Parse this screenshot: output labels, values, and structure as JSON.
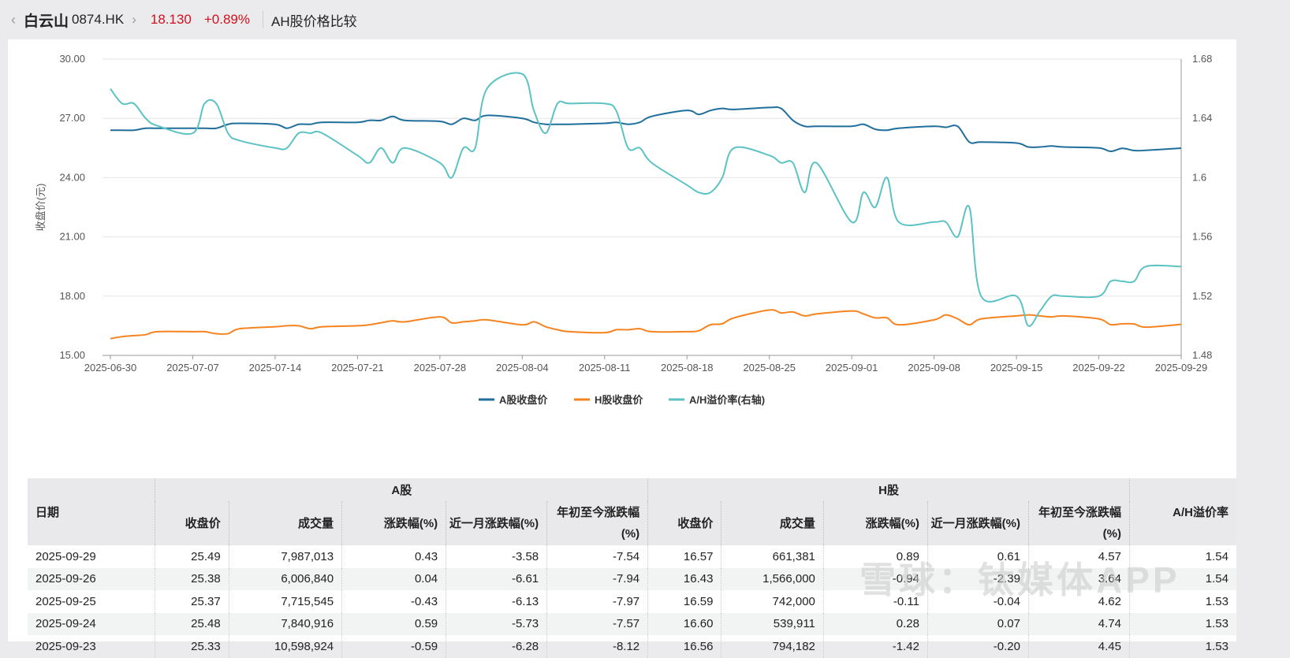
{
  "header": {
    "back_icon": "chevron-left",
    "name": "白云山",
    "code": "0874.HK",
    "next_icon": "chevron-right",
    "price": "18.130",
    "change": "+0.89%",
    "page_title": "AH股价格比较"
  },
  "colors": {
    "a_price": "#1f6e9c",
    "h_price": "#f5831f",
    "ratio": "#5cc2c4",
    "up": "#d0101c"
  },
  "chart_data": {
    "type": "line",
    "ylabel": "收盘价(元)",
    "ylim": [
      15,
      30
    ],
    "y2lim": [
      1.48,
      1.68
    ],
    "yticks": [
      "30.00",
      "27.00",
      "24.00",
      "21.00",
      "18.00",
      "15.00"
    ],
    "y2ticks": [
      "1.68",
      "1.64",
      "1.6",
      "1.56",
      "1.52",
      "1.48"
    ],
    "xticks": [
      "2025-06-30",
      "2025-07-07",
      "2025-07-14",
      "2025-07-21",
      "2025-07-28",
      "2025-08-04",
      "2025-08-11",
      "2025-08-18",
      "2025-08-25",
      "2025-09-01",
      "2025-09-08",
      "2025-09-15",
      "2025-09-22",
      "2025-09-29"
    ],
    "grid": true,
    "legend_position": "bottom",
    "x": [
      "2025-06-30",
      "2025-07-01",
      "2025-07-02",
      "2025-07-03",
      "2025-07-04",
      "2025-07-07",
      "2025-07-08",
      "2025-07-09",
      "2025-07-10",
      "2025-07-11",
      "2025-07-14",
      "2025-07-15",
      "2025-07-16",
      "2025-07-17",
      "2025-07-18",
      "2025-07-21",
      "2025-07-22",
      "2025-07-23",
      "2025-07-24",
      "2025-07-25",
      "2025-07-28",
      "2025-07-29",
      "2025-07-30",
      "2025-07-31",
      "2025-08-01",
      "2025-08-04",
      "2025-08-05",
      "2025-08-06",
      "2025-08-07",
      "2025-08-08",
      "2025-08-11",
      "2025-08-12",
      "2025-08-13",
      "2025-08-14",
      "2025-08-15",
      "2025-08-18",
      "2025-08-19",
      "2025-08-20",
      "2025-08-21",
      "2025-08-22",
      "2025-08-25",
      "2025-08-26",
      "2025-08-27",
      "2025-08-28",
      "2025-08-29",
      "2025-09-01",
      "2025-09-02",
      "2025-09-03",
      "2025-09-04",
      "2025-09-05",
      "2025-09-08",
      "2025-09-09",
      "2025-09-10",
      "2025-09-11",
      "2025-09-12",
      "2025-09-15",
      "2025-09-16",
      "2025-09-17",
      "2025-09-18",
      "2025-09-19",
      "2025-09-22",
      "2025-09-23",
      "2025-09-24",
      "2025-09-25",
      "2025-09-26",
      "2025-09-29"
    ],
    "series": [
      {
        "name": "A股收盘价",
        "axis": "left",
        "values": [
          26.4,
          26.4,
          26.4,
          26.5,
          26.5,
          26.5,
          26.5,
          26.5,
          26.7,
          26.75,
          26.7,
          26.5,
          26.7,
          26.7,
          26.8,
          26.8,
          26.9,
          26.9,
          27.1,
          26.9,
          26.85,
          26.7,
          27.0,
          26.9,
          27.15,
          27.0,
          26.8,
          26.7,
          26.7,
          26.7,
          26.75,
          26.8,
          26.7,
          26.8,
          27.1,
          27.4,
          27.2,
          27.4,
          27.5,
          27.45,
          27.55,
          27.5,
          26.9,
          26.6,
          26.6,
          26.6,
          26.7,
          26.45,
          26.4,
          26.5,
          26.6,
          26.55,
          26.6,
          25.8,
          25.8,
          25.75,
          25.55,
          25.55,
          25.6,
          25.55,
          25.5,
          25.33,
          25.48,
          25.37,
          25.38,
          25.49
        ]
      },
      {
        "name": "H股收盘价",
        "axis": "left",
        "values": [
          15.85,
          15.95,
          16.0,
          16.05,
          16.2,
          16.2,
          16.2,
          16.1,
          16.1,
          16.35,
          16.45,
          16.5,
          16.5,
          16.35,
          16.45,
          16.5,
          16.55,
          16.65,
          16.75,
          16.7,
          16.95,
          16.65,
          16.7,
          16.75,
          16.8,
          16.55,
          16.7,
          16.45,
          16.3,
          16.2,
          16.15,
          16.3,
          16.3,
          16.35,
          16.2,
          16.2,
          16.25,
          16.55,
          16.6,
          16.9,
          17.3,
          17.15,
          17.2,
          17.0,
          17.1,
          17.25,
          17.1,
          16.9,
          16.9,
          16.55,
          16.8,
          17.05,
          16.85,
          16.55,
          16.85,
          17.0,
          17.05,
          17.0,
          16.95,
          17.0,
          16.85,
          16.56,
          16.6,
          16.59,
          16.43,
          16.57
        ]
      },
      {
        "name": "A/H溢价率(右轴)",
        "axis": "right",
        "values": [
          1.66,
          1.65,
          1.65,
          1.64,
          1.635,
          1.63,
          1.65,
          1.65,
          1.63,
          1.625,
          1.62,
          1.62,
          1.63,
          1.63,
          1.63,
          1.615,
          1.61,
          1.62,
          1.61,
          1.62,
          1.61,
          1.6,
          1.62,
          1.62,
          1.66,
          1.67,
          1.645,
          1.63,
          1.65,
          1.65,
          1.65,
          1.645,
          1.62,
          1.62,
          1.61,
          1.595,
          1.59,
          1.59,
          1.6,
          1.62,
          1.615,
          1.61,
          1.61,
          1.59,
          1.61,
          1.57,
          1.59,
          1.58,
          1.6,
          1.57,
          1.57,
          1.57,
          1.56,
          1.58,
          1.52,
          1.52,
          1.5,
          1.51,
          1.52,
          1.52,
          1.52,
          1.53,
          1.53,
          1.53,
          1.54,
          1.54
        ]
      }
    ]
  },
  "table": {
    "date_header": "日期",
    "a_group": "A股",
    "h_group": "H股",
    "ratio_header": "A/H溢价率",
    "sub_headers": [
      "收盘价",
      "成交量",
      "涨跌幅(%)",
      "近一月涨跌幅(%)",
      "年初至今涨跌幅(%)"
    ],
    "rows": [
      [
        "2025-09-29",
        "25.49",
        "7,987,013",
        "0.43",
        "-3.58",
        "-7.54",
        "16.57",
        "661,381",
        "0.89",
        "0.61",
        "4.57",
        "1.54"
      ],
      [
        "2025-09-26",
        "25.38",
        "6,006,840",
        "0.04",
        "-6.61",
        "-7.94",
        "16.43",
        "1,566,000",
        "-0.94",
        "-2.39",
        "3.64",
        "1.54"
      ],
      [
        "2025-09-25",
        "25.37",
        "7,715,545",
        "-0.43",
        "-6.13",
        "-7.97",
        "16.59",
        "742,000",
        "-0.11",
        "-0.04",
        "4.62",
        "1.53"
      ],
      [
        "2025-09-24",
        "25.48",
        "7,840,916",
        "0.59",
        "-5.73",
        "-7.57",
        "16.60",
        "539,911",
        "0.28",
        "0.07",
        "4.74",
        "1.53"
      ],
      [
        "2025-09-23",
        "25.33",
        "10,598,924",
        "-0.59",
        "-6.28",
        "-8.12",
        "16.56",
        "794,182",
        "-1.42",
        "-0.20",
        "4.45",
        "1.53"
      ]
    ]
  },
  "watermark": "雪球：钛媒体APP"
}
